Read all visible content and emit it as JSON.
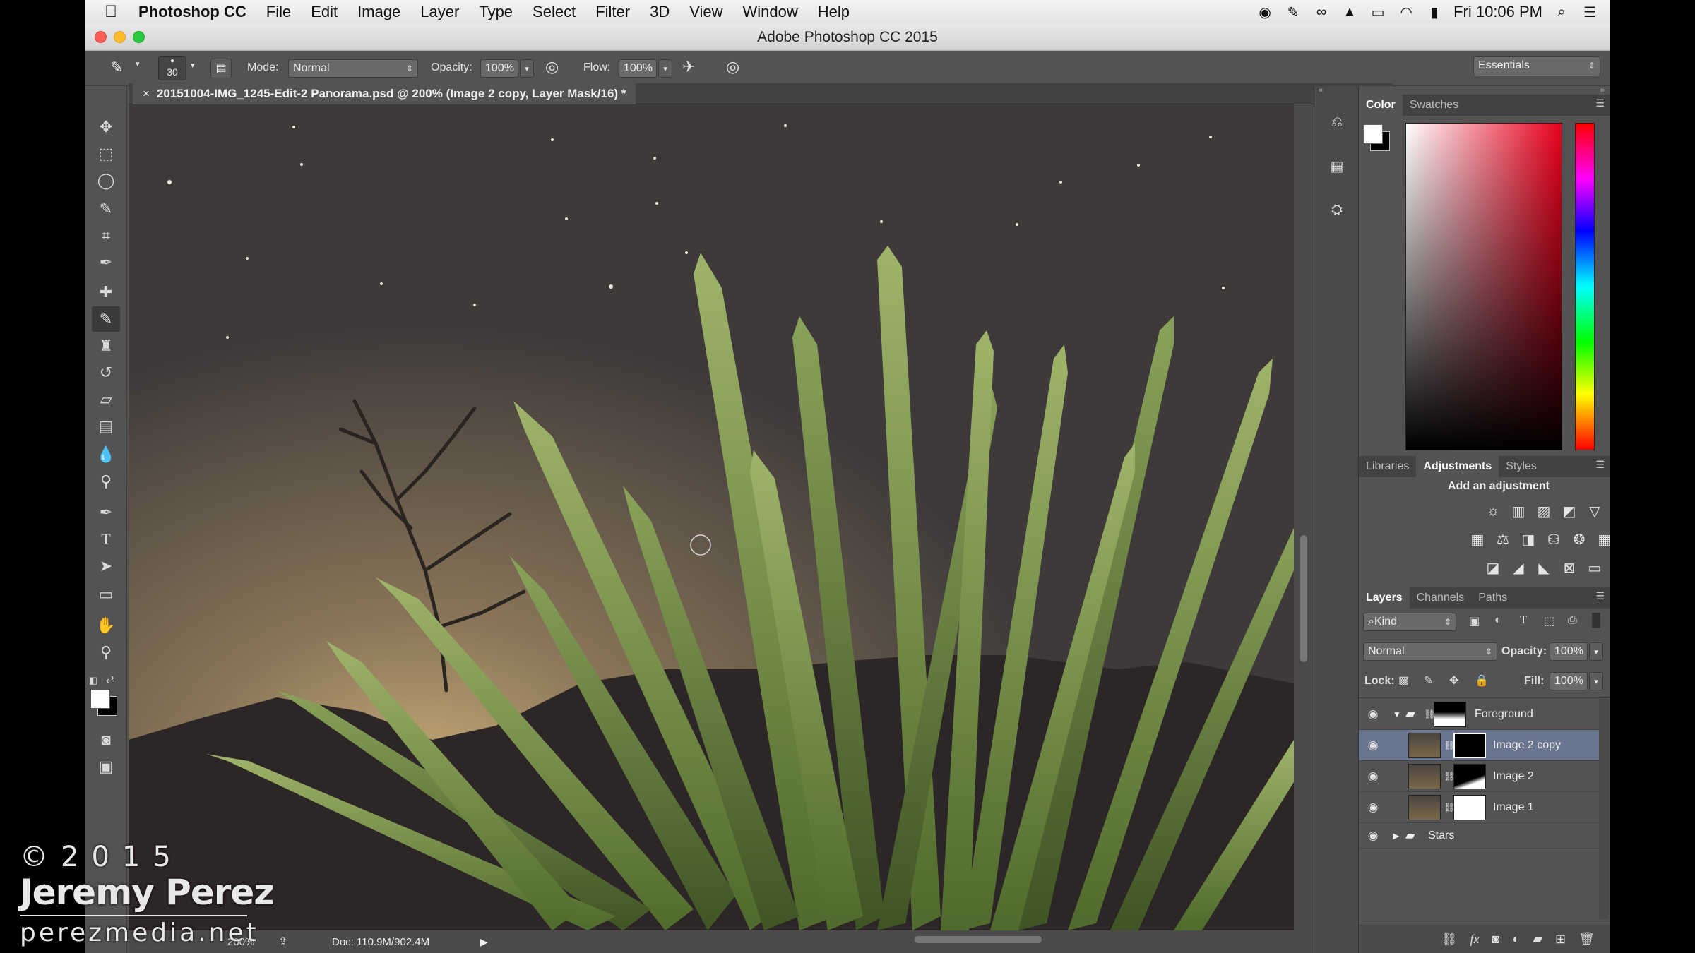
{
  "menubar": {
    "app_name": "Photoshop CC",
    "items": [
      "File",
      "Edit",
      "Image",
      "Layer",
      "Type",
      "Select",
      "Filter",
      "3D",
      "View",
      "Window",
      "Help"
    ],
    "clock": "Fri 10:06 PM"
  },
  "window": {
    "title": "Adobe Photoshop CC 2015"
  },
  "options": {
    "brush_size": "30",
    "mode_label": "Mode:",
    "mode_value": "Normal",
    "opacity_label": "Opacity:",
    "opacity_value": "100%",
    "flow_label": "Flow:",
    "flow_value": "100%",
    "workspace": "Essentials"
  },
  "document": {
    "tab_title": "20151004-IMG_1245-Edit-2 Panorama.psd @ 200% (Image 2 copy, Layer Mask/16) *",
    "zoom": "200%",
    "doc_size": "Doc: 110.9M/902.4M"
  },
  "color_panel": {
    "tabs": [
      "Color",
      "Swatches"
    ],
    "active": "Color"
  },
  "adjustments_panel": {
    "tabs": [
      "Libraries",
      "Adjustments",
      "Styles"
    ],
    "active": "Adjustments",
    "heading": "Add an adjustment"
  },
  "layers_panel": {
    "tabs": [
      "Layers",
      "Channels",
      "Paths"
    ],
    "active": "Layers",
    "filter_kind": "Kind",
    "blend_mode": "Normal",
    "opacity_label": "Opacity:",
    "opacity_value": "100%",
    "lock_label": "Lock:",
    "fill_label": "Fill:",
    "fill_value": "100%",
    "layers": [
      {
        "name": "Foreground"
      },
      {
        "name": "Image 2 copy"
      },
      {
        "name": "Image 2"
      },
      {
        "name": "Image 1"
      },
      {
        "name": "Stars"
      }
    ]
  },
  "watermark": {
    "year": "©2015",
    "name": "Jeremy Perez",
    "site": "perezmedia.net"
  }
}
